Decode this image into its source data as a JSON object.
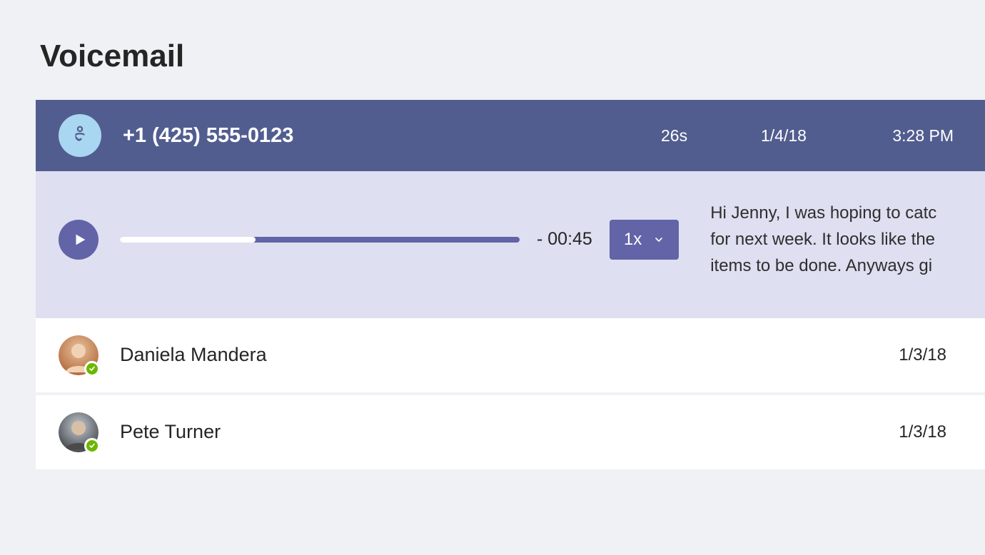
{
  "page": {
    "title": "Voicemail"
  },
  "selected": {
    "caller": "+1 (425) 555-0123",
    "duration": "26s",
    "date": "1/4/18",
    "time": "3:28 PM",
    "time_remaining": "- 00:45",
    "speed_label": "1x",
    "progress_percent": 34,
    "transcript": "Hi Jenny, I was hoping to catc\nfor next week. It looks like the\nitems to be done. Anyways gi"
  },
  "items": [
    {
      "name": "Daniela Mandera",
      "date": "1/3/18",
      "presence": "available",
      "avatar_colors": [
        "#d9a97a",
        "#c86e3f"
      ]
    },
    {
      "name": "Pete Turner",
      "date": "1/3/18",
      "presence": "available",
      "avatar_colors": [
        "#a7b7c6",
        "#43464c"
      ]
    }
  ]
}
